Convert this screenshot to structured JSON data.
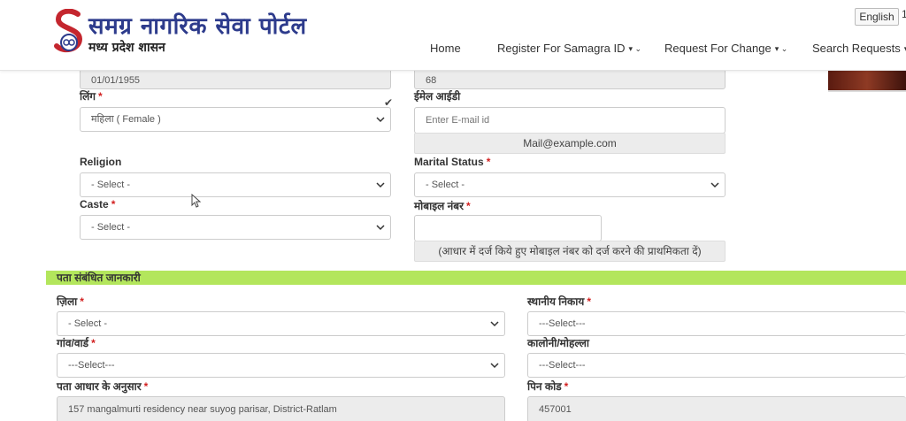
{
  "header": {
    "brand_title": "समग्र नागरिक सेवा पोर्टल",
    "brand_subtitle": "मध्य प्रदेश शासन",
    "language_button": "English",
    "language_edge": "1",
    "nav": [
      {
        "label": "Home",
        "caret": ""
      },
      {
        "label": "Register For Samagra ID",
        "caret": "▾ ⌄"
      },
      {
        "label": "Request For Change",
        "caret": "▾ ⌄"
      },
      {
        "label": "Search Requests",
        "caret": "▾"
      }
    ]
  },
  "personal": {
    "dob_value": "01/01/1955",
    "age_value": "68",
    "gender": {
      "label": "लिंग",
      "value": "महिला ( Female )"
    },
    "email": {
      "label": "ईमेल आईडी",
      "placeholder": "Enter E-mail id",
      "hint": "Mail@example.com"
    },
    "religion": {
      "label": "Religion",
      "value": "- Select -"
    },
    "marital": {
      "label": "Marital Status",
      "value": "- Select -"
    },
    "caste": {
      "label": "Caste",
      "value": "- Select -"
    },
    "mobile": {
      "label": "मोबाइल नंबर",
      "value": "",
      "hint": "(आधार में दर्ज किये हुए मोबाइल नंबर को दर्ज करने की प्राथमिकता दें)"
    }
  },
  "address": {
    "section_title": "पता संबंधित जानकारी",
    "district": {
      "label": "ज़िला",
      "value": "- Select -"
    },
    "local_body": {
      "label": "स्थानीय निकाय",
      "value": "---Select---"
    },
    "village": {
      "label": "गांव/वार्ड",
      "value": "---Select---"
    },
    "colony": {
      "label": "कालोनी/मोहल्ला",
      "value": "---Select---"
    },
    "aadhaar_address": {
      "label": "पता आधार के अनुसार",
      "value": "157 mangalmurti residency near suyog parisar, District-Ratlam"
    },
    "pincode": {
      "label": "पिन कोड",
      "value": "457001"
    }
  },
  "required_marker": "*",
  "colors": {
    "brand": "#2d3b8c",
    "section_bar": "#b3e65c",
    "required": "#d21f1f"
  }
}
